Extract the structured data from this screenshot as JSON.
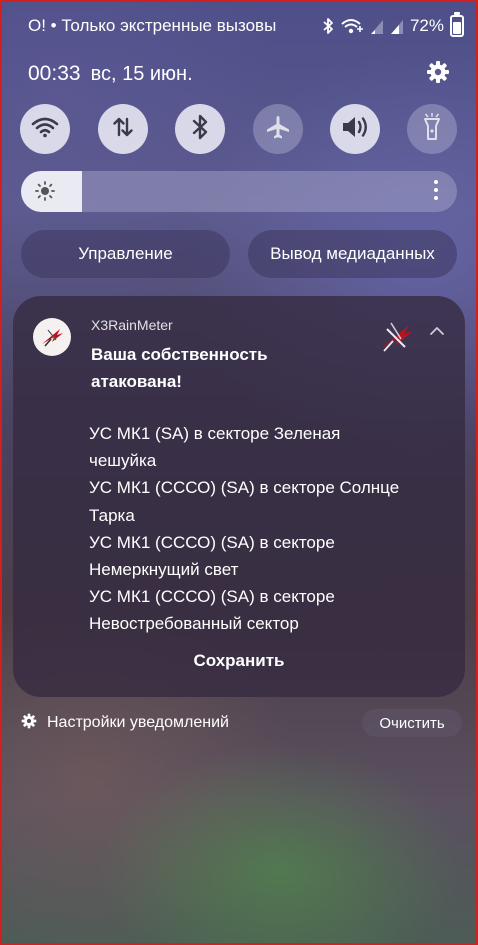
{
  "status_bar": {
    "left_text": "О! • Только экстренные вызовы",
    "battery_percent": "72%",
    "battery_level": 0.72,
    "icons": [
      "bluetooth-icon",
      "wifi-call-icon",
      "signal-icon",
      "signal-icon",
      "battery-icon"
    ]
  },
  "panel": {
    "time": "00:33",
    "date": "вс, 15 июн.",
    "settings_icon": "gear-icon"
  },
  "quick_toggles": [
    {
      "name": "wifi",
      "icon": "wifi-icon",
      "state": "on"
    },
    {
      "name": "mobile-data",
      "icon": "data-arrows-icon",
      "state": "on"
    },
    {
      "name": "bluetooth",
      "icon": "bluetooth-icon",
      "state": "on"
    },
    {
      "name": "airplane",
      "icon": "airplane-icon",
      "state": "off"
    },
    {
      "name": "sound",
      "icon": "volume-icon",
      "state": "on"
    },
    {
      "name": "flashlight",
      "icon": "flashlight-icon",
      "state": "off"
    }
  ],
  "brightness": {
    "level": 0.14,
    "icon": "sun-icon",
    "menu_icon": "more-vertical-icon"
  },
  "buttons": {
    "control_label": "Управление",
    "media_output_label": "Вывод медиаданных"
  },
  "notification": {
    "app_name": "X3RainMeter",
    "title_line1": "Ваша собственность",
    "title_line2": "атакована!",
    "body_lines": [
      "УС МК1 (SA) в секторе Зеленая",
      "чешуйка",
      "УС МК1 (СССО) (SA) в секторе Солнце",
      "Тарка",
      "УС МК1 (СССО) (SA) в секторе",
      "Немеркнущий свет",
      "УС МК1 (СССО) (SA) в секторе",
      "Невостребованный сектор"
    ],
    "action_label": "Сохранить",
    "accent_color": "#c0101a"
  },
  "footer": {
    "settings_label": "Настройки уведомлений",
    "clear_label": "Очистить"
  }
}
